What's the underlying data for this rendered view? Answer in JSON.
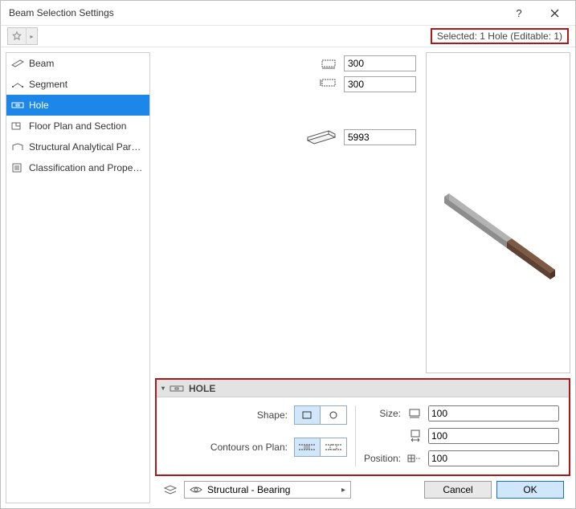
{
  "titlebar": {
    "title": "Beam Selection Settings"
  },
  "selected_text": "Selected: 1 Hole (Editable: 1)",
  "sidebar": {
    "items": [
      {
        "label": "Beam"
      },
      {
        "label": "Segment"
      },
      {
        "label": "Hole"
      },
      {
        "label": "Floor Plan and Section"
      },
      {
        "label": "Structural Analytical Paramet..."
      },
      {
        "label": "Classification and Properties"
      }
    ]
  },
  "params": {
    "width": "300",
    "height": "300",
    "length": "5993"
  },
  "hole": {
    "title": "HOLE",
    "shape_label": "Shape:",
    "contours_label": "Contours on Plan:",
    "size_label": "Size:",
    "position_label": "Position:",
    "size_w": "100",
    "size_h": "100",
    "position": "100"
  },
  "footer": {
    "layer": "Structural - Bearing",
    "cancel": "Cancel",
    "ok": "OK"
  }
}
